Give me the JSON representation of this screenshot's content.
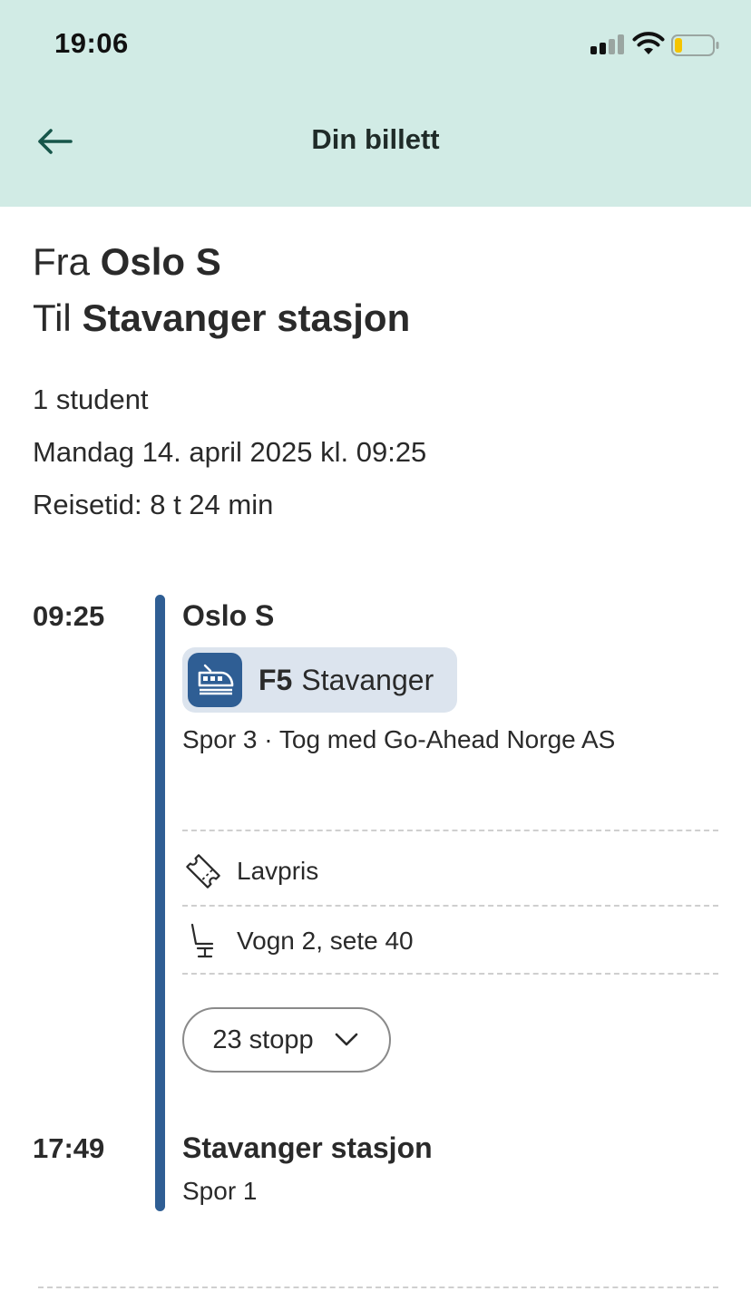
{
  "status_bar": {
    "time": "19:06",
    "signal_icon": "cellular-signal-icon",
    "wifi_icon": "wifi-icon",
    "battery_icon": "battery-low-icon",
    "battery_level": 0.2,
    "battery_color": "#f5c400"
  },
  "header": {
    "title": "Din billett",
    "back_icon": "arrow-left-icon",
    "background": "#d1ebe5"
  },
  "route": {
    "from_prefix": "Fra",
    "from": "Oslo S",
    "to_prefix": "Til",
    "to": "Stavanger stasjon"
  },
  "summary": {
    "travellers": "1 student",
    "date": "Mandag 14. april 2025 kl. 09:25",
    "duration": "Reisetid: 8 t 24 min"
  },
  "departure": {
    "time": "09:25",
    "station": "Oslo S",
    "line_icon": "train-icon",
    "line_code": "F5",
    "line_destination": "Stavanger",
    "track_operator": "Spor 3 · Tog med Go-Ahead Norge AS",
    "accent_color": "#2f5e94"
  },
  "details": [
    {
      "icon": "ticket-icon",
      "label": "Lavpris"
    },
    {
      "icon": "seat-icon",
      "label": "Vogn 2, sete 40"
    }
  ],
  "stops_button": {
    "label": "23 stopp",
    "icon": "chevron-down-icon"
  },
  "arrival": {
    "time": "17:49",
    "station": "Stavanger stasjon",
    "track": "Spor 1"
  }
}
